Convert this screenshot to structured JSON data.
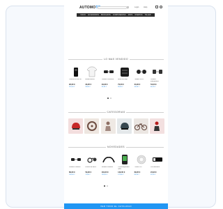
{
  "header": {
    "logo_main": "AUTOMO",
    "logo_accent": "TO",
    "search_placeholder": "",
    "link_1": "Login",
    "link_2": "Help"
  },
  "nav": {
    "items": [
      "Inicio",
      "Accesorios",
      "Bicicletas",
      "Componentes",
      "Ropa",
      "Ofertas",
      "Taller"
    ]
  },
  "sections": {
    "featured_title": "LO MAS VENDIDO",
    "categories_title": "CATEGORIAS",
    "novelties_title": "NOVEDADES"
  },
  "featured_products": [
    {
      "icon": "camera-icon",
      "name": "Camara accion 4K",
      "price": "92,00 €",
      "old": "119,00 €"
    },
    {
      "icon": "shirt-icon",
      "name": "Maillot blanco",
      "price": "29,95 €",
      "old": "39,95 €"
    },
    {
      "icon": "pedal-icon",
      "name": "Pedales carretera",
      "price": "49,90 €",
      "old": "59,90 €"
    },
    {
      "icon": "bag-icon",
      "name": "Bolsa de viaje",
      "price": "79,00 €",
      "old": "99,00 €"
    },
    {
      "icon": "pedal-icon",
      "name": "Pedales MTB",
      "price": "34,90 €",
      "old": "44,90 €"
    },
    {
      "icon": "pedal-icon",
      "name": "Pedales automaticos",
      "price": "54,00 €",
      "old": "64,00 €"
    }
  ],
  "categories": [
    {
      "icon": "helmet-icon",
      "color": "#c62828"
    },
    {
      "icon": "wheel-icon",
      "color": "#6d4c41"
    },
    {
      "icon": "rider-icon",
      "color": "#8d6e63"
    },
    {
      "icon": "helmet-icon",
      "color": "#37474f"
    },
    {
      "icon": "bike-icon",
      "color": "#5d4037"
    },
    {
      "icon": "rider-icon",
      "color": "#b71c1c"
    }
  ],
  "novelty_products": [
    {
      "icon": "pedal-icon",
      "name": "Pedales carbono",
      "price": "89,00 €",
      "old": "109,00 €"
    },
    {
      "icon": "brake-icon",
      "name": "Frenos de disco",
      "price": "59,90 €",
      "old": "74,90 €"
    },
    {
      "icon": "handlebar-icon",
      "name": "Manillar carbono",
      "price": "119,00 €",
      "old": "139,00 €"
    },
    {
      "icon": "phone-icon",
      "name": "Ciclocomputador GPS",
      "price": "149,00 €",
      "old": "179,00 €"
    },
    {
      "icon": "cassette-icon",
      "name": "Casete 11v",
      "price": "69,95 €",
      "old": "84,95 €"
    },
    {
      "icon": "light-icon",
      "name": "Luz delantera",
      "price": "24,90 €",
      "old": "32,90 €"
    }
  ],
  "footer": {
    "banner_text": "Ver todo el catalogo"
  },
  "colors": {
    "accent": "#1e88e5",
    "nav_bg": "#2b2b2b",
    "footer_bg": "#2196f3"
  }
}
